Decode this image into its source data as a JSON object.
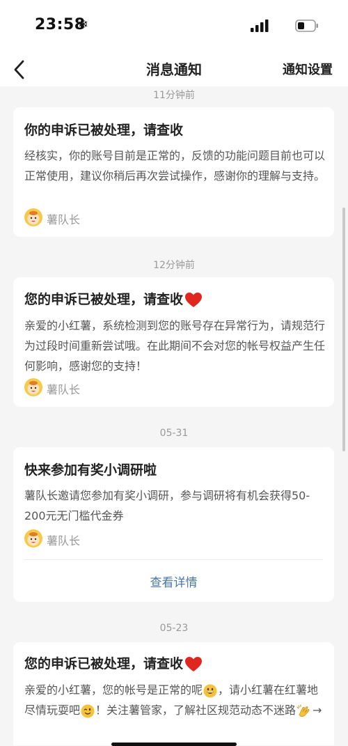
{
  "status_bar": {
    "time": "23:58",
    "snow_glyph": "❄",
    "icons": [
      "signal-icon",
      "battery-icon"
    ]
  },
  "nav": {
    "title": "消息通知",
    "settings": "通知设置",
    "back_icon": "chevron-left-icon"
  },
  "colors": {
    "link": "#4a76a8",
    "heart": "#e0271f",
    "background": "#f5f5f5"
  },
  "messages": [
    {
      "time": "11分钟前",
      "title": "你的申诉已被处理，请查收",
      "body": "经核实，你的账号目前是正常的，反馈的功能问题目前也可以正常使用，建议你稍后再次尝试操作，感谢你的理解与支持。",
      "author": "薯队长"
    },
    {
      "time": "12分钟前",
      "title": "您的申诉已被处理，请查收",
      "title_icon": "heart-icon",
      "body": "亲爱的小红薯，系统检测到您的账号存在异常行为，请规范行为过段时间重新尝试哦。在此期间不会对您的帐号权益产生任何影响，感谢您的支持！",
      "author": "薯队长"
    },
    {
      "time": "05-31",
      "title": "快来参加有奖小调研啦",
      "body": "薯队长邀请您参加有奖小调研，参与调研将有机会获得50-200元无门槛代金券",
      "author": "薯队长",
      "link": "查看详情"
    },
    {
      "time": "05-23",
      "title": "您的申诉已被处理，请查收",
      "title_icon": "heart-icon",
      "body_part1": "亲爱的小红薯，您的帐号是正常的呢",
      "body_part2": "，请小红薯在红薯地尽情玩耍吧",
      "body_part3": "！关注薯管家，了解社区规范动态不迷路",
      "body_part4": "→",
      "body_icons": [
        "grinning-face-icon",
        "winking-face-icon",
        "clapping-hands-icon"
      ]
    }
  ]
}
